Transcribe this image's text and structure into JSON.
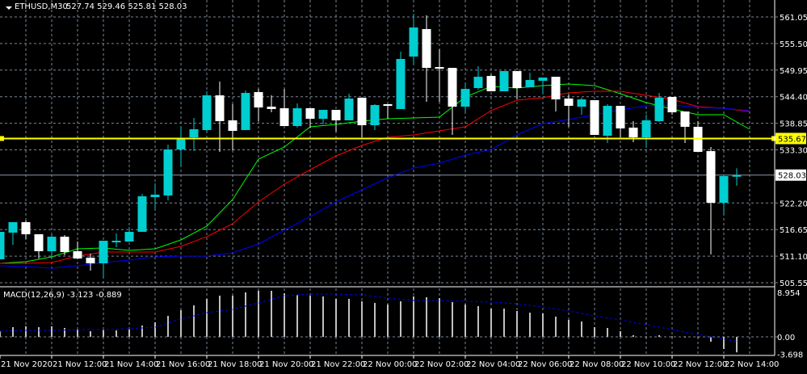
{
  "header": {
    "symbol_tf": "ETHUSD,M30",
    "ohlc": "527.74 529.46 525.81 528.03"
  },
  "colors": {
    "bull": "#00CED1",
    "bear": "#FFFFFF",
    "ma_fast": "#00FF00",
    "ma_mid": "#FF0000",
    "ma_slow": "#0000FF",
    "hline": "#FFFF00",
    "histogram": "#C0C0C0",
    "signal": "#0000FF",
    "grid": "#7a8796"
  },
  "chart_data": {
    "type": "candlestick",
    "title": "ETHUSD,M30",
    "price_ticks": [
      "561.05",
      "555.50",
      "549.95",
      "544.40",
      "538.85",
      "533.30",
      "522.20",
      "516.65",
      "511.10",
      "505.55"
    ],
    "ylim": [
      505.55,
      561.05
    ],
    "current_price": "528.03",
    "horizontal_line": "535.67",
    "x_labels": [
      "21 Nov 2020",
      "21 Nov 12:00",
      "21 Nov 14:00",
      "21 Nov 16:00",
      "21 Nov 18:00",
      "21 Nov 20:00",
      "21 Nov 22:00",
      "22 Nov 00:00",
      "22 Nov 02:00",
      "22 Nov 04:00",
      "22 Nov 06:00",
      "22 Nov 08:00",
      "22 Nov 10:00",
      "22 Nov 12:00",
      "22 Nov 14:00"
    ],
    "x_label_every_n_bars": 4,
    "candles": [
      [
        510.44,
        516.18,
        510.44,
        516.18
      ],
      [
        516.01,
        518.2,
        513.48,
        518.2
      ],
      [
        518.2,
        518.54,
        514.66,
        515.67
      ],
      [
        515.67,
        515.67,
        510.61,
        512.13
      ],
      [
        512.13,
        515.84,
        510.44,
        515.16
      ],
      [
        515.16,
        515.5,
        511.28,
        511.96
      ],
      [
        512.13,
        514.15,
        510.44,
        510.61
      ],
      [
        510.78,
        511.62,
        508.08,
        509.6
      ],
      [
        509.6,
        514.32,
        506.39,
        514.32
      ],
      [
        513.98,
        515.84,
        512.97,
        514.32
      ],
      [
        514.15,
        517.19,
        514.15,
        516.18
      ],
      [
        516.18,
        524.1,
        516.18,
        523.6
      ],
      [
        523.43,
        526.3,
        520.73,
        523.94
      ],
      [
        523.77,
        534.39,
        522.75,
        533.38
      ],
      [
        533.38,
        538.27,
        529.84,
        535.58
      ],
      [
        535.91,
        539.96,
        533.04,
        537.6
      ],
      [
        537.43,
        545.53,
        537.09,
        544.68
      ],
      [
        544.68,
        547.55,
        532.88,
        539.29
      ],
      [
        539.46,
        542.83,
        533.21,
        537.26
      ],
      [
        537.43,
        545.7,
        537.43,
        545.19
      ],
      [
        545.36,
        546.03,
        539.29,
        542.15
      ],
      [
        542.32,
        544.68,
        541.14,
        541.82
      ],
      [
        541.99,
        546.03,
        538.27,
        538.27
      ],
      [
        538.27,
        543.0,
        537.94,
        541.99
      ],
      [
        541.99,
        541.99,
        537.94,
        539.79
      ],
      [
        539.79,
        541.65,
        538.61,
        541.65
      ],
      [
        541.65,
        541.65,
        537.09,
        539.46
      ],
      [
        539.46,
        545.02,
        539.46,
        544.01
      ],
      [
        544.18,
        544.18,
        535.91,
        538.44
      ],
      [
        538.44,
        542.83,
        537.43,
        542.66
      ],
      [
        542.83,
        542.83,
        539.79,
        542.49
      ],
      [
        541.82,
        553.79,
        541.82,
        552.28
      ],
      [
        552.78,
        561.72,
        551.09,
        558.85
      ],
      [
        558.52,
        561.38,
        543.34,
        550.42
      ],
      [
        550.59,
        554.3,
        543.34,
        550.25
      ],
      [
        550.42,
        550.42,
        536.42,
        542.32
      ],
      [
        542.32,
        547.21,
        541.14,
        546.03
      ],
      [
        546.2,
        550.76,
        545.87,
        548.56
      ],
      [
        548.73,
        549.07,
        545.53,
        545.53
      ],
      [
        545.53,
        549.75,
        545.53,
        549.75
      ],
      [
        549.75,
        549.75,
        543.84,
        546.2
      ],
      [
        546.37,
        549.41,
        546.37,
        547.89
      ],
      [
        547.72,
        548.4,
        545.02,
        548.4
      ],
      [
        548.56,
        548.56,
        541.31,
        543.84
      ],
      [
        544.01,
        544.85,
        538.11,
        542.49
      ],
      [
        542.32,
        544.18,
        540.64,
        543.84
      ],
      [
        543.67,
        543.67,
        536.42,
        536.42
      ],
      [
        536.25,
        542.83,
        534.73,
        542.49
      ],
      [
        542.49,
        542.49,
        535.91,
        537.77
      ],
      [
        537.94,
        539.29,
        534.9,
        535.91
      ],
      [
        535.91,
        540.64,
        533.89,
        539.46
      ],
      [
        539.29,
        545.19,
        539.12,
        544.18
      ],
      [
        544.35,
        544.35,
        540.64,
        541.14
      ],
      [
        541.31,
        541.31,
        534.73,
        538.11
      ],
      [
        538.11,
        539.29,
        532.88,
        532.88
      ],
      [
        533.04,
        533.89,
        511.45,
        522.25
      ],
      [
        522.25,
        527.82,
        519.72,
        527.82
      ],
      [
        527.74,
        529.46,
        525.81,
        528.03
      ]
    ],
    "ma_sample_every_n_bars": 2,
    "ma_fast": [
      509.6,
      509.93,
      510.95,
      512.63,
      512.8,
      512.3,
      512.63,
      514.49,
      517.36,
      522.92,
      531.36,
      533.89,
      538.1,
      538.61,
      539.29,
      539.79,
      539.96,
      540.13,
      544.35,
      546.54,
      546.2,
      546.71,
      547.05,
      546.71,
      545.02,
      543.17,
      541.82,
      540.64,
      540.64,
      537.6
    ],
    "ma_mid": [
      509.6,
      509.6,
      509.77,
      511.12,
      511.96,
      511.96,
      511.96,
      513.14,
      515.16,
      517.86,
      522.42,
      526.13,
      529.16,
      532.03,
      534.23,
      535.91,
      536.42,
      537.26,
      538.1,
      541.48,
      543.67,
      544.18,
      545.19,
      545.53,
      545.53,
      544.68,
      543.84,
      542.32,
      541.99,
      541.31
    ],
    "ma_slow": [
      509.09,
      508.92,
      508.58,
      509.09,
      509.76,
      510.27,
      510.95,
      511.12,
      511.12,
      511.79,
      513.65,
      516.51,
      519.38,
      522.42,
      524.95,
      527.48,
      529.5,
      530.52,
      532.2,
      533.38,
      536.42,
      538.78,
      539.62,
      540.64,
      541.65,
      542.49,
      542.66,
      542.15,
      541.99,
      541.48
    ],
    "macd": {
      "label": "MACD(12,26,9) -3.123 -0.889",
      "axis_ticks": [
        "8.954",
        "0.00",
        "-3.698"
      ],
      "ylim": [
        -3.698,
        8.954
      ],
      "histogram": [
        1.14,
        1.95,
        2.12,
        1.95,
        2.12,
        1.79,
        1.47,
        1.14,
        1.47,
        1.3,
        1.47,
        2.28,
        2.93,
        4.23,
        5.37,
        6.35,
        7.65,
        8.3,
        8.3,
        8.95,
        9.28,
        9.28,
        8.79,
        8.47,
        8.3,
        8.14,
        7.65,
        7.65,
        7.16,
        6.84,
        6.51,
        7.16,
        8.14,
        7.98,
        7.81,
        7.0,
        6.51,
        6.19,
        5.7,
        5.7,
        5.21,
        4.88,
        4.72,
        4.07,
        3.42,
        3.09,
        1.95,
        1.79,
        1.14,
        0.33,
        0.05,
        0.33,
        0.1,
        0.05,
        0.05,
        -0.98,
        -2.44,
        -3.123
      ],
      "signal_sample_every_n_bars": 2,
      "signal": [
        1.14,
        1.3,
        1.3,
        1.47,
        1.47,
        1.63,
        1.95,
        3.58,
        4.88,
        5.54,
        6.84,
        8.3,
        8.63,
        8.63,
        8.47,
        7.81,
        7.33,
        7.33,
        7.16,
        7.0,
        6.67,
        6.02,
        5.21,
        4.23,
        3.42,
        2.44,
        1.47,
        0.49,
        -0.49
      ],
      "signal_last": -0.889
    }
  }
}
